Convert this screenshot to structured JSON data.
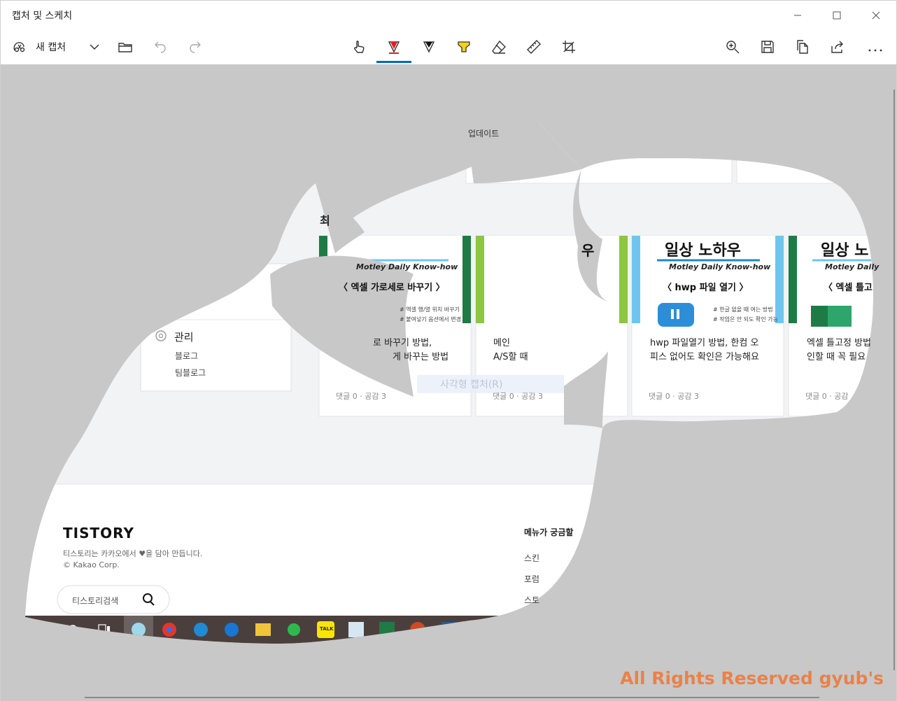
{
  "window": {
    "title": "캡처 및 스케치"
  },
  "toolbar": {
    "new_capture_label": "새 캡처"
  },
  "captured_page": {
    "update_label": "업데이트",
    "section_heading_fragment": "최",
    "sidebar": {
      "manage_label": "관리",
      "links": [
        "블로그",
        "팀블로그"
      ]
    },
    "cards": [
      {
        "banner_line1": "",
        "banner_line2": "Motley Daily Know-how",
        "banner_line3": "〈 엑셀 가로세로 바꾸기 〉",
        "tags": [
          "# 엑셀 행/열 위치 바꾸기",
          "# 붙여넣기 옵션에서 변경"
        ],
        "title_line1": "로 바꾸기 방법,",
        "title_line2": "게 바꾸는 방법",
        "meta": "댓글 0 · 공감 3"
      },
      {
        "title_line1": "메인",
        "title_line2": "A/S할 때",
        "meta": "댓글 0 · 공감 3"
      },
      {
        "banner_line1": "일상 노하우",
        "banner_line2": "Motley Daily Know-how",
        "banner_line3": "〈 hwp 파일 열기 〉",
        "tags": [
          "# 한글 없을 때 여는 방법",
          "# 작업은 안 되도 확인 가능"
        ],
        "title_line1": "hwp 파일열기 방법, 한컴 오",
        "title_line2": "피스 없어도 확인은 가능해요",
        "meta": "댓글 0 · 공감 3"
      },
      {
        "banner_line1": "일상 노",
        "banner_line2": "Motley Daily",
        "banner_line3": "〈 엑셀 틀고",
        "title_line1": "엑셀 틀고정 방법",
        "title_line2": "인할 때 꼭 필요",
        "meta": "댓글 0 · 공감"
      }
    ],
    "banner_top_fragment_1": "일상 노하우",
    "banner_top_fragment_2": "우",
    "overlay_label": "사각형 캡처(R)",
    "footer": {
      "logo": "TISTORY",
      "tagline": "티스토리는 카카오에서 ♥을 담아 만듭니다.",
      "copyright": "© Kakao Corp.",
      "search_placeholder": "티스토리검색",
      "menu_heading": "메뉴가 궁금할",
      "menu_items": [
        "스킨",
        "포럼",
        "스토"
      ]
    },
    "taskbar": {
      "kakao_badge": "TALK"
    }
  },
  "watermark": "All Rights Reserved gyub's",
  "colors": {
    "accent": "#0067c0",
    "canvas_bg": "#c8c8c8",
    "taskbar": "#4a3f3c",
    "watermark": "#e8824a",
    "excel_green": "#1e7b45",
    "light_blue": "#6ec6f0",
    "lime": "#8dc63f"
  }
}
